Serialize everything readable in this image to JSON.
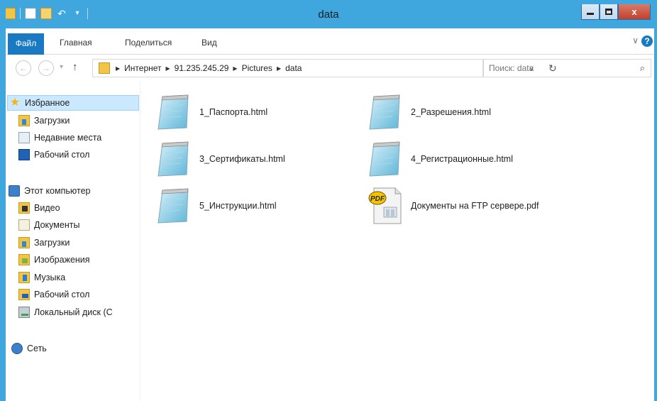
{
  "window": {
    "title": "data",
    "close_glyph": "x"
  },
  "ribbon": {
    "tab_file": "Файл",
    "tab_home": "Главная",
    "tab_share": "Поделиться",
    "tab_view": "Вид"
  },
  "address": {
    "crumbs": [
      "Интернет",
      "91.235.245.29",
      "Pictures",
      "data"
    ]
  },
  "search": {
    "placeholder": "Поиск: data"
  },
  "navpane": {
    "favorites": {
      "label": "Избранное",
      "items": [
        "Загрузки",
        "Недавние места",
        "Рабочий стол"
      ]
    },
    "computer": {
      "label": "Этот компьютер",
      "items": [
        "Видео",
        "Документы",
        "Загрузки",
        "Изображения",
        "Музыка",
        "Рабочий стол",
        "Локальный диск (C"
      ]
    },
    "network": {
      "label": "Сеть"
    }
  },
  "files": [
    {
      "name": "1_Паспорта.html",
      "icon": "html-document-icon"
    },
    {
      "name": "2_Разрешения.html",
      "icon": "html-document-icon"
    },
    {
      "name": "3_Сертификаты.html",
      "icon": "html-document-icon"
    },
    {
      "name": "4_Регистрационные.html",
      "icon": "html-document-icon"
    },
    {
      "name": "5_Инструкции.html",
      "icon": "html-document-icon"
    },
    {
      "name": "Документы на FTP сервере.pdf",
      "icon": "pdf-document-icon",
      "badge": "PDF"
    }
  ],
  "colors": {
    "titlebar": "#3fa6de",
    "file_tab": "#1a79c3",
    "selection": "#cce8ff"
  }
}
